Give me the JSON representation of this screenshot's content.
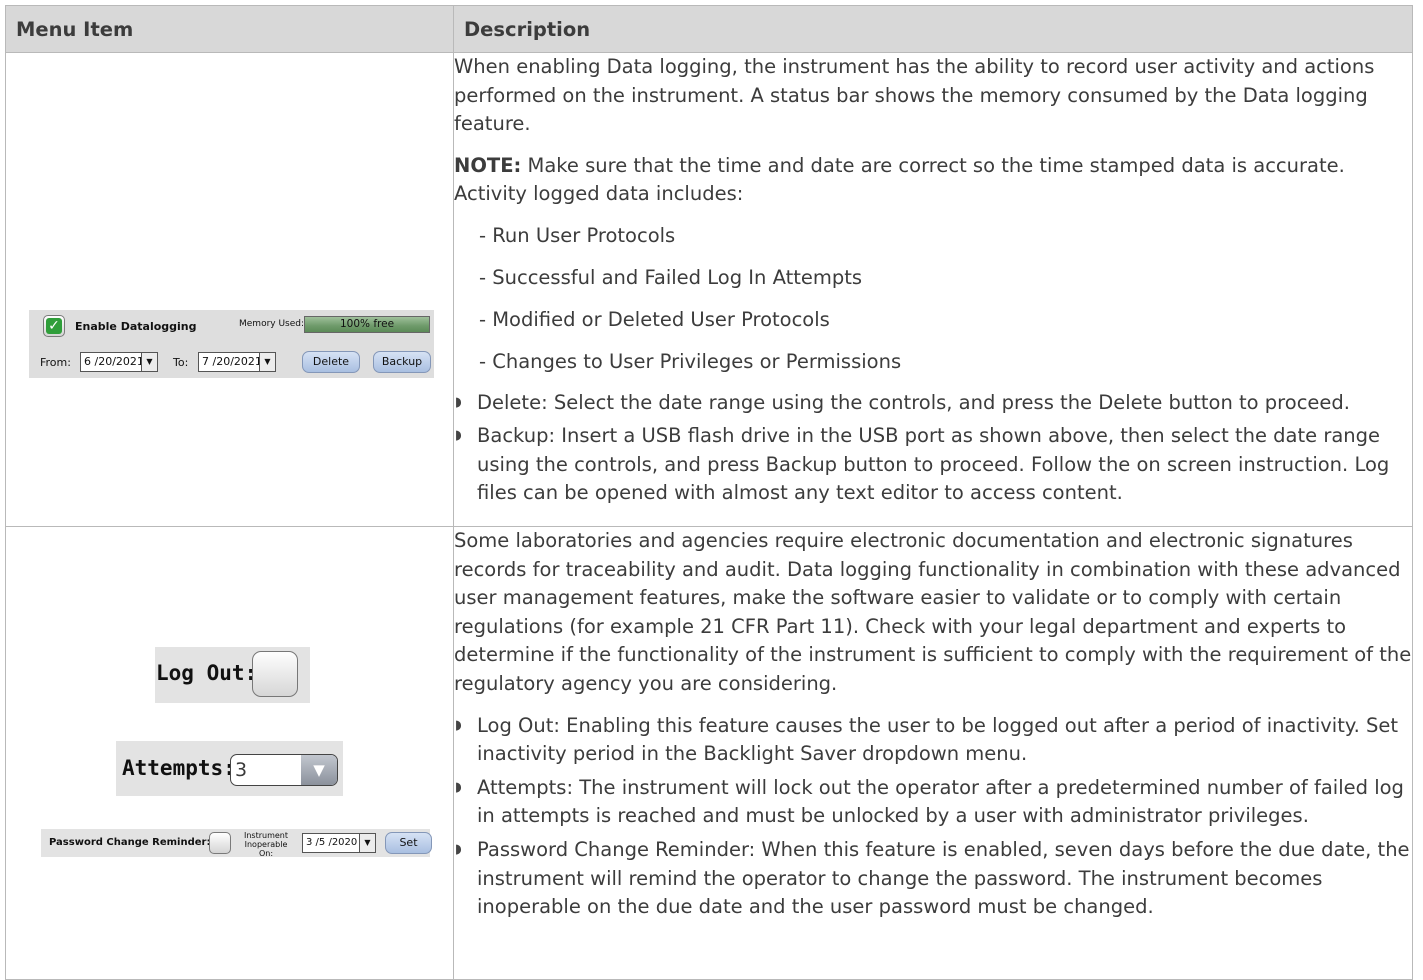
{
  "header": {
    "col1": "Menu Item",
    "col2": "Description"
  },
  "row1": {
    "widget": {
      "enable_label": "Enable Datalogging",
      "memory_label": "Memory Used:",
      "memory_value": "100% free",
      "from_label": "From:",
      "from_date": "6 /20/2021",
      "to_label": "To:",
      "to_date": "7 /20/2021",
      "delete_label": "Delete",
      "backup_label": "Backup",
      "checked": true
    },
    "intro": "When enabling Data logging, the instrument has the ability to record user activity and actions performed on the instrument. A status bar shows the memory consumed by the Data logging feature.",
    "note_label": "NOTE:",
    "note_text": " Make sure that the time and date are correct so the time stamped data is accurate. Activity logged data includes:",
    "dash_items": [
      "- Run User Protocols",
      "- Successful and Failed Log In Attempts",
      "- Modified or Deleted User Protocols",
      "- Changes to User Privileges or Permissions"
    ],
    "bullets": [
      "Delete: Select the date range using the controls, and press the Delete button to proceed.",
      "Backup: Insert a USB flash drive in the USB port as shown above, then select the date range using the controls, and press Backup button to proceed. Follow the on screen instruction. Log files can be opened with almost any text editor to access content."
    ]
  },
  "row2": {
    "logout_label": "Log Out:",
    "attempts_label": "Attempts:",
    "attempts_value": "3",
    "pwd_label": "Password Change Reminder:",
    "inoperable_label_1": "Instrument",
    "inoperable_label_2": "Inoperable On:",
    "inoperable_date": "3 /5 /2020",
    "set_label": "Set",
    "intro": "Some laboratories and agencies require electronic documentation and electronic signatures records for traceability and audit. Data logging functionality in combination with these advanced user management features, make the software easier to validate or to comply with certain regulations (for example 21 CFR Part 11). Check with your legal department and experts to determine if the functionality of the instrument is sufficient to comply with the requirement of the regulatory agency you are considering.",
    "bullets": [
      "Log Out: Enabling this feature causes the user to be logged out after a period of inactivity. Set inactivity period in the Backlight Saver dropdown menu.",
      "Attempts: The instrument will lock out the operator after a predetermined number of failed log in attempts is reached and must be unlocked by a user with administrator privileges.",
      "Password Change Reminder: When this feature is enabled, seven days before the due date, the instrument will remind the operator to change the password. The instrument becomes inoperable on the due date and the user password must be changed."
    ]
  }
}
